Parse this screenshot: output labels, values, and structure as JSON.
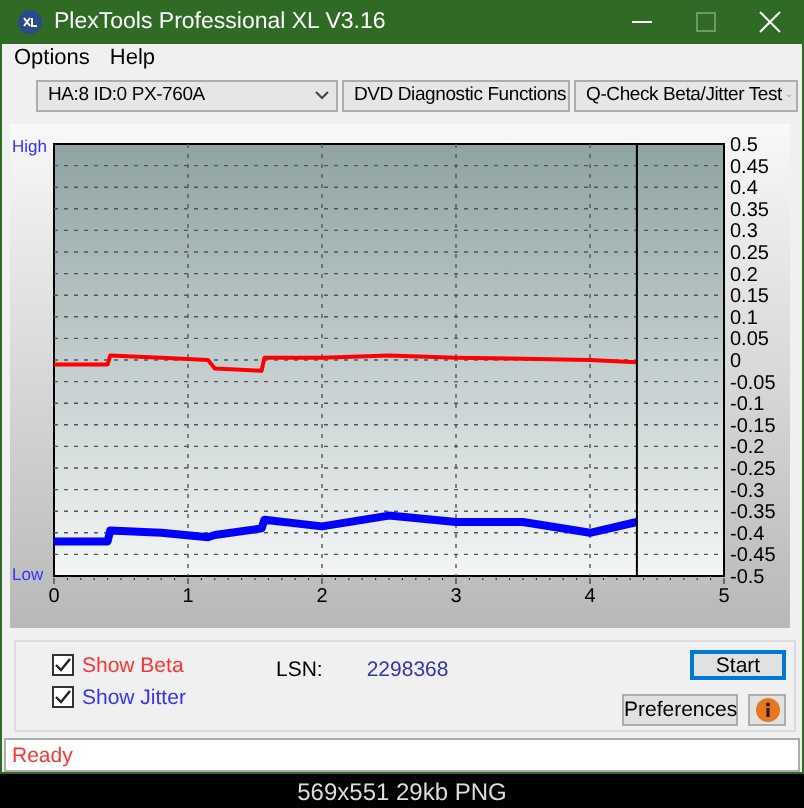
{
  "window": {
    "title": "PlexTools Professional XL V3.16"
  },
  "menu": [
    "Options",
    "Help"
  ],
  "toolbar": {
    "dropdowns": [
      {
        "value": "HA:8 ID:0  PX-760A"
      },
      {
        "value": "DVD Diagnostic Functions"
      },
      {
        "value": "Q-Check Beta/Jitter Test"
      }
    ]
  },
  "chart": {
    "high_label": "High",
    "low_label": "Low",
    "chart_data": {
      "type": "line",
      "xlim": [
        0,
        5
      ],
      "ylim": [
        -0.5,
        0.5
      ],
      "xticks": [
        0,
        1,
        2,
        3,
        4,
        5
      ],
      "yticks": [
        {
          "value": 0.5,
          "label": "0.5"
        },
        {
          "value": 0.45,
          "label": "0.45"
        },
        {
          "value": 0.4,
          "label": "0.4"
        },
        {
          "value": 0.35,
          "label": "0.35"
        },
        {
          "value": 0.3,
          "label": "0.3"
        },
        {
          "value": 0.25,
          "label": "0.25"
        },
        {
          "value": 0.2,
          "label": "0.2"
        },
        {
          "value": 0.15,
          "label": "0.15"
        },
        {
          "value": 0.1,
          "label": "0.1"
        },
        {
          "value": 0.05,
          "label": "0.05"
        },
        {
          "value": 0,
          "label": "0"
        },
        {
          "value": -0.05,
          "label": "-0.05"
        },
        {
          "value": -0.1,
          "label": "-0.1"
        },
        {
          "value": -0.15,
          "label": "-0.15"
        },
        {
          "value": -0.2,
          "label": "-0.2"
        },
        {
          "value": -0.25,
          "label": "-0.25"
        },
        {
          "value": -0.3,
          "label": "-0.3"
        },
        {
          "value": -0.35,
          "label": "-0.35"
        },
        {
          "value": -0.4,
          "label": "-0.4"
        },
        {
          "value": -0.45,
          "label": "-0.45"
        },
        {
          "value": -0.5,
          "label": "-0.5"
        }
      ],
      "x": [
        0,
        0.2,
        0.4,
        0.42,
        0.8,
        1.15,
        1.2,
        1.55,
        1.57,
        2,
        2.5,
        3,
        3.5,
        4,
        4.35
      ],
      "series": [
        {
          "color": "#ff0000",
          "values": [
            -0.01,
            -0.01,
            -0.01,
            0.01,
            0.005,
            0.0,
            -0.02,
            -0.025,
            0.005,
            0.005,
            0.01,
            0.005,
            0.003,
            0.0,
            -0.005
          ]
        },
        {
          "color": "#0000ff",
          "values": [
            -0.42,
            -0.42,
            -0.42,
            -0.395,
            -0.4,
            -0.41,
            -0.405,
            -0.39,
            -0.37,
            -0.385,
            -0.36,
            -0.375,
            -0.375,
            -0.4,
            -0.375
          ]
        }
      ],
      "grid": true,
      "ref_lines": [
        {
          "axis": "x",
          "value": 4.35
        }
      ]
    }
  },
  "options": {
    "checkboxes": [
      {
        "label": "Show Beta",
        "checked": true,
        "color": "#ff3333"
      },
      {
        "label": "Show Jitter",
        "checked": true,
        "color": "#3333ff"
      }
    ],
    "lsn_label": "LSN:",
    "lsn_value": "2298368",
    "buttons": [
      {
        "kind": "text",
        "label": "Start",
        "focused": true
      },
      {
        "kind": "text",
        "label": "Preferences",
        "focused": false
      },
      {
        "kind": "info",
        "focused": false
      }
    ]
  },
  "status_bar": {
    "text": "Ready"
  },
  "image_caption": "569x551 29kb PNG"
}
